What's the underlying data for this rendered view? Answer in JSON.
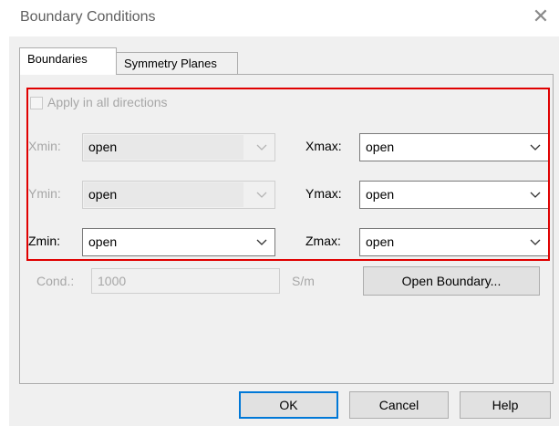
{
  "window": {
    "title": "Boundary Conditions",
    "close_glyph": "✕"
  },
  "tabs": [
    {
      "label": "Boundaries",
      "active": true
    },
    {
      "label": "Symmetry Planes",
      "active": false
    }
  ],
  "apply_all": {
    "label": "Apply in all directions",
    "checked": false,
    "enabled": false
  },
  "boundaries": {
    "xmin": {
      "label": "Xmin:",
      "value": "open",
      "enabled": false
    },
    "xmax": {
      "label": "Xmax:",
      "value": "open",
      "enabled": true
    },
    "ymin": {
      "label": "Ymin:",
      "value": "open",
      "enabled": false
    },
    "ymax": {
      "label": "Ymax:",
      "value": "open",
      "enabled": true
    },
    "zmin": {
      "label": "Zmin:",
      "value": "open",
      "enabled": true
    },
    "zmax": {
      "label": "Zmax:",
      "value": "open",
      "enabled": true
    }
  },
  "conductivity": {
    "label": "Cond.:",
    "value": "1000",
    "unit": "S/m",
    "enabled": false
  },
  "buttons": {
    "open_boundary": "Open Boundary...",
    "ok": "OK",
    "cancel": "Cancel",
    "help": "Help"
  },
  "colors": {
    "highlight": "#e00000",
    "focus": "#0078d7"
  }
}
